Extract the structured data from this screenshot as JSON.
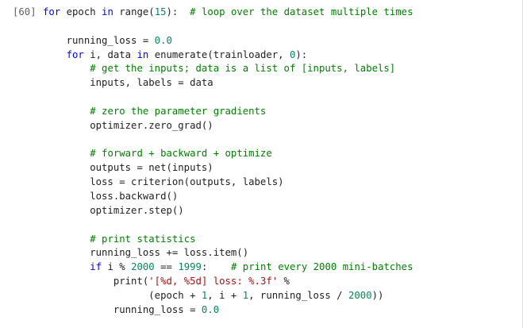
{
  "cell": {
    "prompt": "[60]",
    "lines": [
      [
        {
          "t": "for ",
          "c": "kw"
        },
        {
          "t": "epoch ",
          "c": "plain"
        },
        {
          "t": "in ",
          "c": "kw"
        },
        {
          "t": "range",
          "c": "plain"
        },
        {
          "t": "(",
          "c": "plain"
        },
        {
          "t": "15",
          "c": "num"
        },
        {
          "t": "):  ",
          "c": "plain"
        },
        {
          "t": "# loop over the dataset multiple times",
          "c": "cm"
        }
      ],
      [],
      [
        {
          "t": "    running_loss = ",
          "c": "plain"
        },
        {
          "t": "0.0",
          "c": "num"
        }
      ],
      [
        {
          "t": "    ",
          "c": "plain"
        },
        {
          "t": "for ",
          "c": "kw"
        },
        {
          "t": "i, data ",
          "c": "plain"
        },
        {
          "t": "in ",
          "c": "kw"
        },
        {
          "t": "enumerate",
          "c": "plain"
        },
        {
          "t": "(trainloader, ",
          "c": "plain"
        },
        {
          "t": "0",
          "c": "num"
        },
        {
          "t": "):",
          "c": "plain"
        }
      ],
      [
        {
          "t": "        ",
          "c": "plain"
        },
        {
          "t": "# get the inputs; data is a list of [inputs, labels]",
          "c": "cm"
        }
      ],
      [
        {
          "t": "        inputs, labels = data",
          "c": "plain"
        }
      ],
      [],
      [
        {
          "t": "        ",
          "c": "plain"
        },
        {
          "t": "# zero the parameter gradients",
          "c": "cm"
        }
      ],
      [
        {
          "t": "        optimizer.zero_grad()",
          "c": "plain"
        }
      ],
      [],
      [
        {
          "t": "        ",
          "c": "plain"
        },
        {
          "t": "# forward + backward + optimize",
          "c": "cm"
        }
      ],
      [
        {
          "t": "        outputs = net(inputs)",
          "c": "plain"
        }
      ],
      [
        {
          "t": "        loss = criterion(outputs, labels)",
          "c": "plain"
        }
      ],
      [
        {
          "t": "        loss.backward()",
          "c": "plain"
        }
      ],
      [
        {
          "t": "        optimizer.step()",
          "c": "plain"
        }
      ],
      [],
      [
        {
          "t": "        ",
          "c": "plain"
        },
        {
          "t": "# print statistics",
          "c": "cm"
        }
      ],
      [
        {
          "t": "        running_loss += loss.item()",
          "c": "plain"
        }
      ],
      [
        {
          "t": "        ",
          "c": "plain"
        },
        {
          "t": "if ",
          "c": "kw"
        },
        {
          "t": "i % ",
          "c": "plain"
        },
        {
          "t": "2000",
          "c": "num"
        },
        {
          "t": " == ",
          "c": "plain"
        },
        {
          "t": "1999",
          "c": "num"
        },
        {
          "t": ":    ",
          "c": "plain"
        },
        {
          "t": "# print every 2000 mini-batches",
          "c": "cm"
        }
      ],
      [
        {
          "t": "            ",
          "c": "plain"
        },
        {
          "t": "print",
          "c": "plain"
        },
        {
          "t": "(",
          "c": "plain"
        },
        {
          "t": "'[%d, %5d] loss: %.3f'",
          "c": "str"
        },
        {
          "t": " %",
          "c": "plain"
        }
      ],
      [
        {
          "t": "                  (epoch + ",
          "c": "plain"
        },
        {
          "t": "1",
          "c": "num"
        },
        {
          "t": ", i + ",
          "c": "plain"
        },
        {
          "t": "1",
          "c": "num"
        },
        {
          "t": ", running_loss / ",
          "c": "plain"
        },
        {
          "t": "2000",
          "c": "num"
        },
        {
          "t": "))",
          "c": "plain"
        }
      ],
      [
        {
          "t": "            running_loss = ",
          "c": "plain"
        },
        {
          "t": "0.0",
          "c": "num"
        }
      ]
    ]
  },
  "colors": {
    "keyword": "#0000ff",
    "number": "#098658",
    "string": "#a31515",
    "comment": "#008000",
    "text": "#212121",
    "prompt": "#616161"
  }
}
